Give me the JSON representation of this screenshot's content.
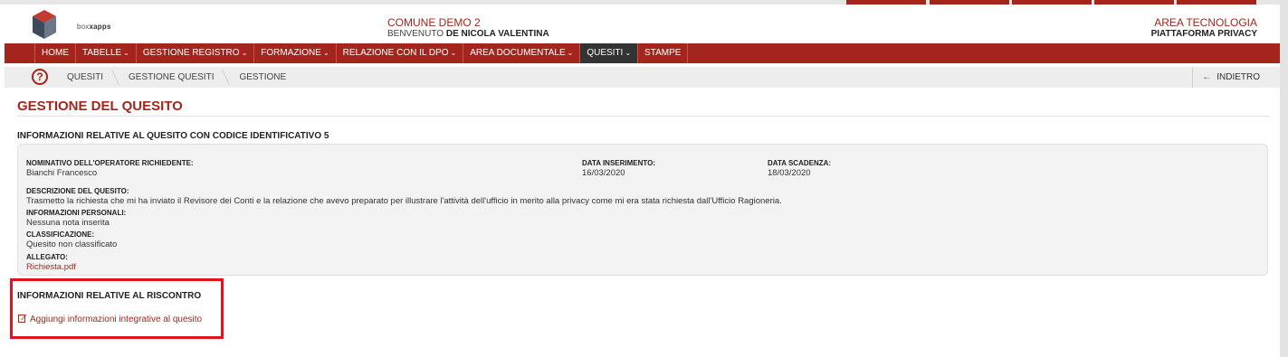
{
  "header": {
    "logo_brand_regular": "box",
    "logo_brand_bold": "xapps",
    "comune": "COMUNE DEMO 2",
    "welcome_prefix": "BENVENUTO",
    "welcome_user": "DE NICOLA VALENTINA",
    "area": "AREA TECNOLOGIA",
    "platform": "PIATTAFORMA PRIVACY"
  },
  "nav": {
    "items": [
      {
        "label": "HOME"
      },
      {
        "label": "TABELLE",
        "caret": "⌄"
      },
      {
        "label": "GESTIONE REGISTRO",
        "caret": "⌄"
      },
      {
        "label": "FORMAZIONE",
        "caret": "⌄"
      },
      {
        "label": "RELAZIONE CON IL DPO",
        "caret": "⌄"
      },
      {
        "label": "AREA DOCUMENTALE",
        "caret": "⌄"
      },
      {
        "label": "QUESITI",
        "caret": "⌄"
      },
      {
        "label": "STAMPE"
      }
    ]
  },
  "breadcrumb": {
    "help_glyph": "?",
    "items": [
      "QUESITI",
      "GESTIONE QUESITI",
      "GESTIONE"
    ],
    "back_arrow": "←",
    "back_label": "INDIETRO"
  },
  "page": {
    "title": "GESTIONE DEL QUESITO",
    "info_heading": "INFORMAZIONI RELATIVE AL QUESITO CON CODICE IDENTIFICATIVO 5",
    "riscontro_heading": "INFORMAZIONI RELATIVE AL RISCONTRO",
    "add_link": "Aggiungi informazioni integrative al quesito"
  },
  "quesito": {
    "operator_label": "NOMINATIVO DELL'OPERATORE RICHIEDENTE:",
    "operator_value": "Bianchi Francesco",
    "inserted_label": "DATA INSERIMENTO:",
    "inserted_value": "16/03/2020",
    "deadline_label": "DATA SCADENZA:",
    "deadline_value": "18/03/2020",
    "description_label": "DESCRIZIONE DEL QUESITO:",
    "description_value": "Trasmetto la richiesta che mi ha inviato il Revisore dei Conti e la relazione che avevo preparato per illustrare l'attività dell'ufficio in merito alla privacy come mi era stata richiesta dall'Ufficio Ragioneria.",
    "personal_label": "INFORMAZIONI PERSONALI:",
    "personal_value": "Nessuna nota inserita",
    "classification_label": "CLASSIFICAZIONE:",
    "classification_value": "Quesito non classificato",
    "attachment_label": "ALLEGATO:",
    "attachment_value": "Richiesta.pdf"
  },
  "colors": {
    "brand": "#a4251e",
    "active_nav": "#333333",
    "highlight": "#e0141e"
  }
}
